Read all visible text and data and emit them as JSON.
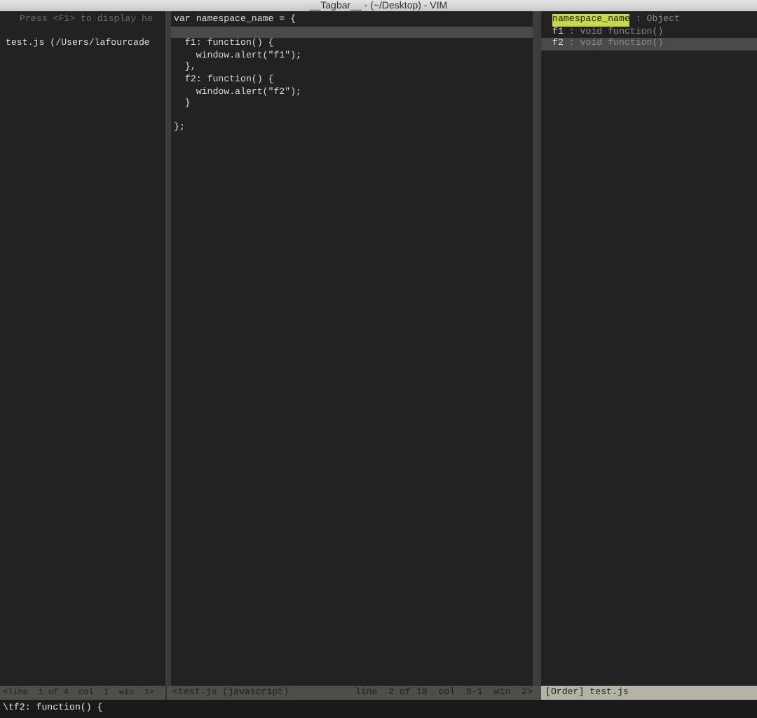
{
  "window": {
    "title": "__Tagbar__ - (~/Desktop) - VIM"
  },
  "file_pane": {
    "lines": [
      {
        "text": "Press <F1> to display he",
        "kind": "help"
      },
      {
        "kind": "blank"
      },
      {
        "text": "test.js (/Users/lafourcade",
        "kind": "file"
      }
    ]
  },
  "code_pane": {
    "lines": [
      {
        "text": "var namespace_name = {",
        "cursorline": false
      },
      {
        "cursorline": true
      },
      {
        "text": "  f1: function() {",
        "cursorline": false
      },
      {
        "text": "    window.alert(\"f1\");",
        "cursorline": false
      },
      {
        "text": "  },",
        "cursorline": false
      },
      {
        "text": "  f2: function() {",
        "cursorline": false
      },
      {
        "text": "    window.alert(\"f2\");",
        "cursorline": false
      },
      {
        "text": "  }",
        "cursorline": false
      },
      {
        "cursorline": false
      },
      {
        "text": "};",
        "cursorline": false
      }
    ]
  },
  "tag_pane": {
    "tags": [
      {
        "name": "namespace_name",
        "type": " : Object",
        "selected": true,
        "cursorline": false
      },
      {
        "name": "f1",
        "type": " : void function()",
        "selected": false,
        "cursorline": false
      },
      {
        "name": "f2",
        "type": " : void function()",
        "selected": false,
        "cursorline": true
      }
    ]
  },
  "status_bar": {
    "file_status": "<line  1 of 4  col  1  win  1>",
    "code_status_left": "<test.js (javascript)",
    "code_status_right": "line  2 of 10  col  8-1  win  2>",
    "tag_status": "[Order] test.js"
  },
  "command_line": "\\tf2: function() {"
}
